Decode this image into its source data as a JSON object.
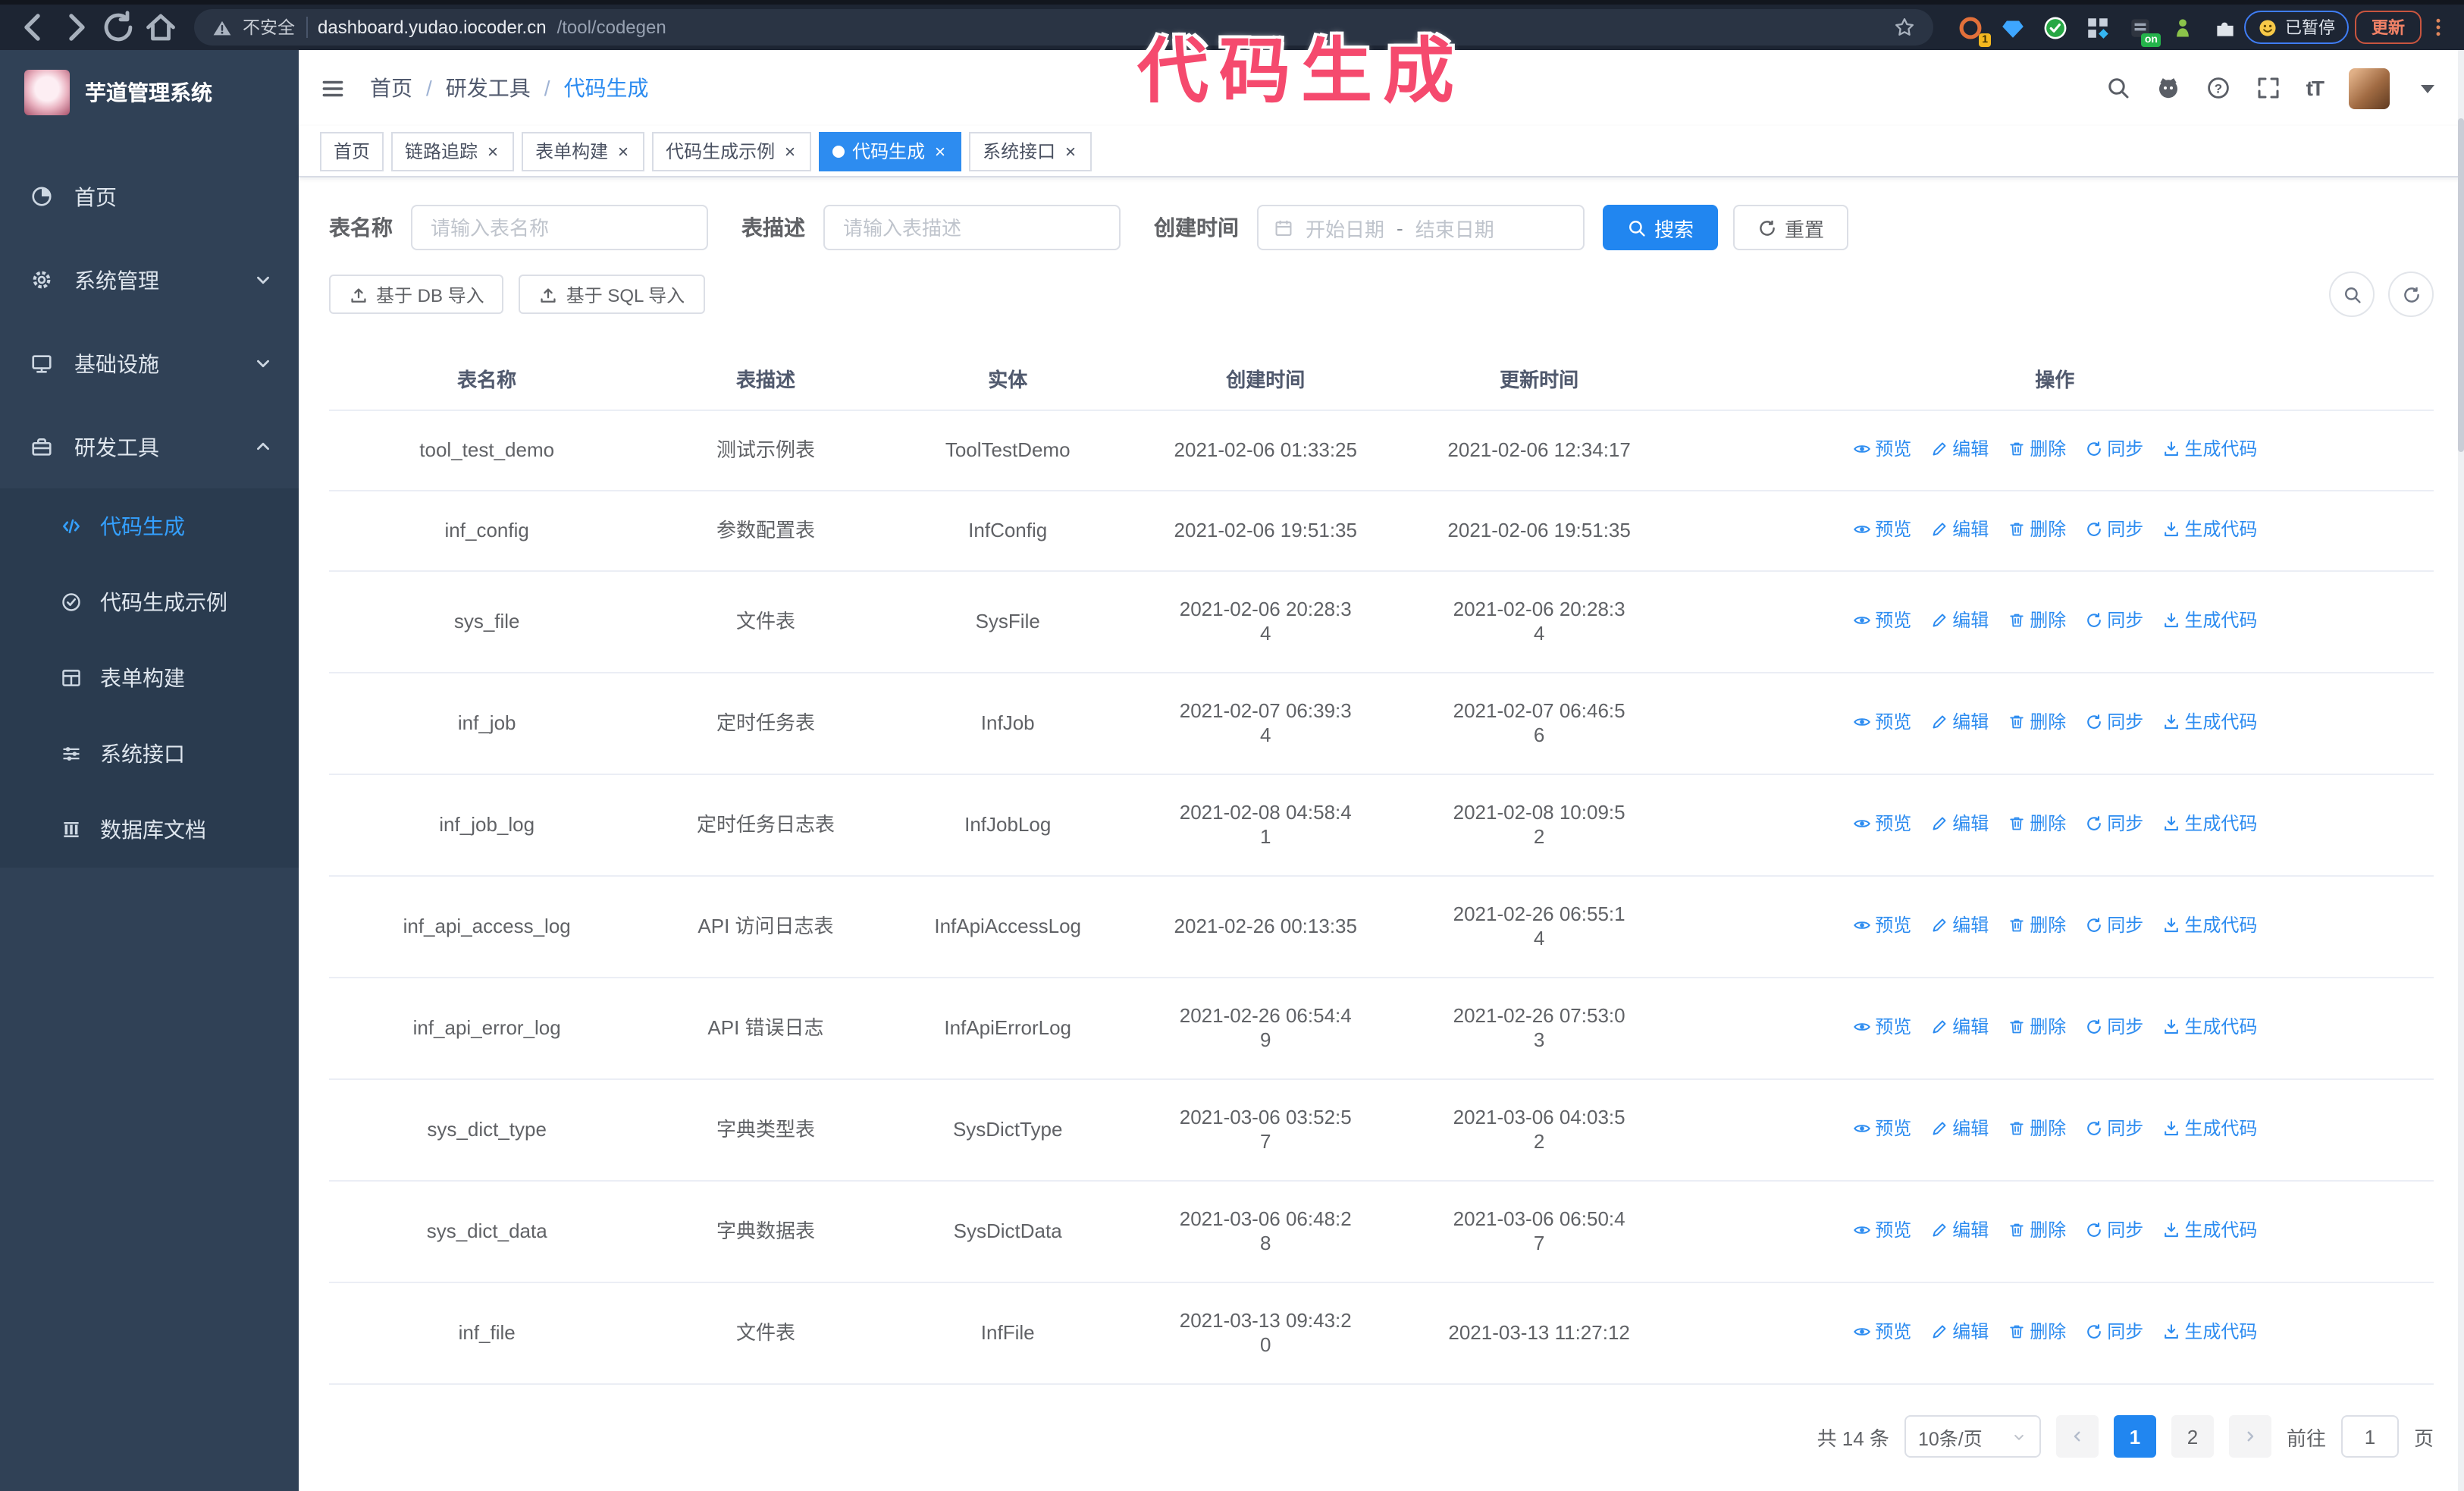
{
  "browser": {
    "security_label": "不安全",
    "url_host": "dashboard.yudao.iocoder.cn",
    "url_path": "/tool/codegen",
    "extensions": [
      "ext-orange-icon",
      "ext-gem-icon",
      "ext-shield-icon",
      "ext-grid-icon",
      "ext-dark-icon",
      "ext-green-icon",
      "ext-puzzle-icon"
    ],
    "extension_badge": "1",
    "on_badge": "on",
    "paused_badge": "已暂停",
    "update_button": "更新"
  },
  "overlay_title": "代码生成",
  "sidebar": {
    "title": "芋道管理系统",
    "items": [
      {
        "label": "首页",
        "icon": "dashboard-icon"
      },
      {
        "label": "系统管理",
        "icon": "gear-icon",
        "chevron": "down"
      },
      {
        "label": "基础设施",
        "icon": "monitor-icon",
        "chevron": "down"
      },
      {
        "label": "研发工具",
        "icon": "toolbox-icon",
        "chevron": "up",
        "children": [
          {
            "label": "代码生成",
            "icon": "code-icon",
            "active": true
          },
          {
            "label": "代码生成示例",
            "icon": "badge-check-icon"
          },
          {
            "label": "表单构建",
            "icon": "form-icon"
          },
          {
            "label": "系统接口",
            "icon": "sliders-icon"
          },
          {
            "label": "数据库文档",
            "icon": "database-icon"
          }
        ]
      }
    ]
  },
  "topbar": {
    "breadcrumb": [
      "首页",
      "研发工具",
      "代码生成"
    ]
  },
  "tags": [
    {
      "label": "首页",
      "closable": false,
      "active": false
    },
    {
      "label": "链路追踪",
      "closable": true,
      "active": false
    },
    {
      "label": "表单构建",
      "closable": true,
      "active": false
    },
    {
      "label": "代码生成示例",
      "closable": true,
      "active": false
    },
    {
      "label": "代码生成",
      "closable": true,
      "active": true
    },
    {
      "label": "系统接口",
      "closable": true,
      "active": false
    }
  ],
  "filters": {
    "name_label": "表名称",
    "name_placeholder": "请输入表名称",
    "desc_label": "表描述",
    "desc_placeholder": "请输入表描述",
    "time_label": "创建时间",
    "start_placeholder": "开始日期",
    "range_separator": "-",
    "end_placeholder": "结束日期",
    "search_button": "搜索",
    "reset_button": "重置",
    "import_db_button": "基于 DB 导入",
    "import_sql_button": "基于 SQL 导入"
  },
  "table": {
    "columns": [
      "表名称",
      "表描述",
      "实体",
      "创建时间",
      "更新时间",
      "操作"
    ],
    "actions": [
      {
        "label": "预览",
        "icon": "eye-icon"
      },
      {
        "label": "编辑",
        "icon": "edit-icon"
      },
      {
        "label": "删除",
        "icon": "delete-icon"
      },
      {
        "label": "同步",
        "icon": "sync-icon"
      },
      {
        "label": "生成代码",
        "icon": "generate-icon"
      }
    ],
    "rows": [
      {
        "name": "tool_test_demo",
        "desc": "测试示例表",
        "entity": "ToolTestDemo",
        "created": "2021-02-06 01:33:25",
        "updated": "2021-02-06 12:34:17"
      },
      {
        "name": "inf_config",
        "desc": "参数配置表",
        "entity": "InfConfig",
        "created": "2021-02-06 19:51:35",
        "updated": "2021-02-06 19:51:35"
      },
      {
        "name": "sys_file",
        "desc": "文件表",
        "entity": "SysFile",
        "created": "2021-02-06 20:28:3\n4",
        "updated": "2021-02-06 20:28:3\n4"
      },
      {
        "name": "inf_job",
        "desc": "定时任务表",
        "entity": "InfJob",
        "created": "2021-02-07 06:39:3\n4",
        "updated": "2021-02-07 06:46:5\n6"
      },
      {
        "name": "inf_job_log",
        "desc": "定时任务日志表",
        "entity": "InfJobLog",
        "created": "2021-02-08 04:58:4\n1",
        "updated": "2021-02-08 10:09:5\n2"
      },
      {
        "name": "inf_api_access_log",
        "desc": "API 访问日志表",
        "entity": "InfApiAccessLog",
        "created": "2021-02-26 00:13:35",
        "updated": "2021-02-26 06:55:1\n4"
      },
      {
        "name": "inf_api_error_log",
        "desc": "API 错误日志",
        "entity": "InfApiErrorLog",
        "created": "2021-02-26 06:54:4\n9",
        "updated": "2021-02-26 07:53:0\n3"
      },
      {
        "name": "sys_dict_type",
        "desc": "字典类型表",
        "entity": "SysDictType",
        "created": "2021-03-06 03:52:5\n7",
        "updated": "2021-03-06 04:03:5\n2"
      },
      {
        "name": "sys_dict_data",
        "desc": "字典数据表",
        "entity": "SysDictData",
        "created": "2021-03-06 06:48:2\n8",
        "updated": "2021-03-06 06:50:4\n7"
      },
      {
        "name": "inf_file",
        "desc": "文件表",
        "entity": "InfFile",
        "created": "2021-03-13 09:43:2\n0",
        "updated": "2021-03-13 11:27:12"
      }
    ]
  },
  "pagination": {
    "total": "共 14 条",
    "page_size": "10条/页",
    "pages": [
      {
        "label": "1",
        "active": true
      },
      {
        "label": "2",
        "active": false
      }
    ],
    "goto_label": "前往",
    "goto_value": "1",
    "page_suffix": "页"
  },
  "colors": {
    "primary": "#2186f0",
    "sidebar_bg": "#304156",
    "annotation_pink": "#f54a6e"
  }
}
